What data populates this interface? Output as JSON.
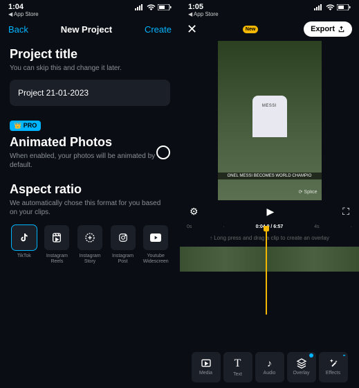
{
  "left": {
    "status": {
      "time": "1:04",
      "app_store": "◀ App Store"
    },
    "nav": {
      "back": "Back",
      "title": "New Project",
      "create": "Create"
    },
    "project": {
      "title": "Project title",
      "desc": "You can skip this and change it later.",
      "value": "Project 21-01-2023"
    },
    "animated": {
      "badge": "👑 PRO",
      "title": "Animated Photos",
      "desc": "When enabled, your photos will be animated by default."
    },
    "aspect": {
      "title": "Aspect ratio",
      "desc": "We automatically chose this format for you based on your clips.",
      "items": [
        {
          "label": "TikTok"
        },
        {
          "label": "Instagram Reels"
        },
        {
          "label": "Instagram Story"
        },
        {
          "label": "Instagram Post"
        },
        {
          "label": "Youtube Widescreen"
        }
      ]
    }
  },
  "right": {
    "status": {
      "time": "1:05",
      "app_store": "◀ App Store"
    },
    "top": {
      "new": "New",
      "export": "Export"
    },
    "preview": {
      "banner": "ONEL MESSI BECOMES WORLD CHAMPIO",
      "splice": "⟳ Splice"
    },
    "ruler": {
      "a": "0s",
      "b": "·",
      "cur": "0:04.0 / 6:57",
      "c": "4s",
      "d": "·"
    },
    "hint": "↑ Long press and drag a clip to create an overlay",
    "tools": [
      {
        "label": "Media"
      },
      {
        "label": "Text"
      },
      {
        "label": "Audio"
      },
      {
        "label": "Overlay"
      },
      {
        "label": "Effects"
      }
    ]
  }
}
